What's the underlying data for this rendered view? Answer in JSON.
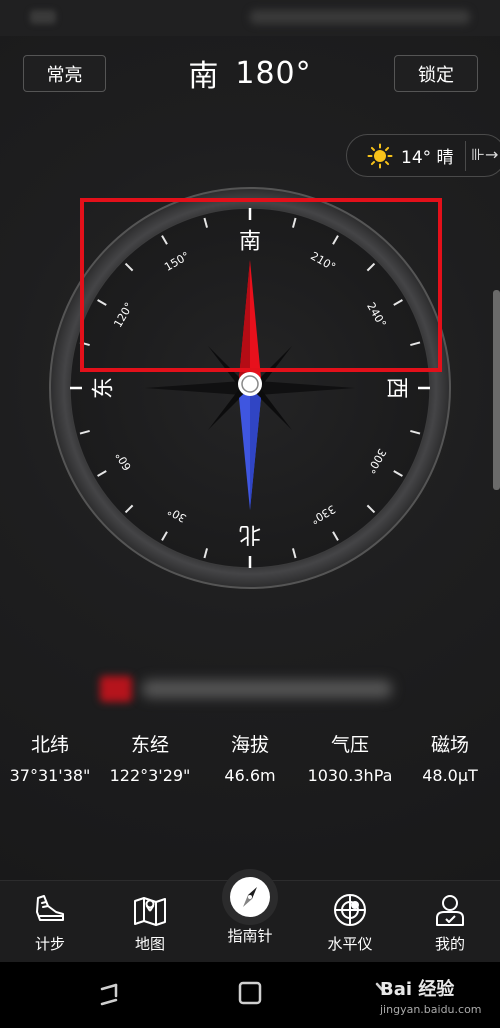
{
  "header": {
    "keep_on_label": "常亮",
    "direction": "南",
    "degrees": "180°",
    "lock_label": "锁定"
  },
  "weather": {
    "icon": "sun-icon",
    "text": "14° 晴",
    "expand": "⊪→"
  },
  "compass": {
    "cardinals": {
      "north": "北",
      "south": "南",
      "east": "东",
      "west": "西"
    },
    "degree_labels": [
      "30°",
      "60°",
      "120°",
      "150°",
      "210°",
      "240°",
      "300°",
      "330°"
    ],
    "heading_value": 180
  },
  "info": [
    {
      "label": "北纬",
      "value": "37°31'38\""
    },
    {
      "label": "东经",
      "value": "122°3'29\""
    },
    {
      "label": "海拔",
      "value": "46.6m"
    },
    {
      "label": "气压",
      "value": "1030.3hPa"
    },
    {
      "label": "磁场",
      "value": "48.0μT"
    }
  ],
  "tabs": [
    {
      "label": "计步",
      "icon": "shoe-icon"
    },
    {
      "label": "地图",
      "icon": "map-icon"
    },
    {
      "label": "指南针",
      "icon": "compass-icon"
    },
    {
      "label": "水平仪",
      "icon": "level-icon"
    },
    {
      "label": "我的",
      "icon": "user-icon"
    }
  ],
  "watermark": {
    "brand": "Bai 经验",
    "url": "jingyan.baidu.com"
  },
  "colors": {
    "needle_red": "#e8101c",
    "needle_blue": "#3f56e0",
    "highlight": "#e3101a"
  }
}
